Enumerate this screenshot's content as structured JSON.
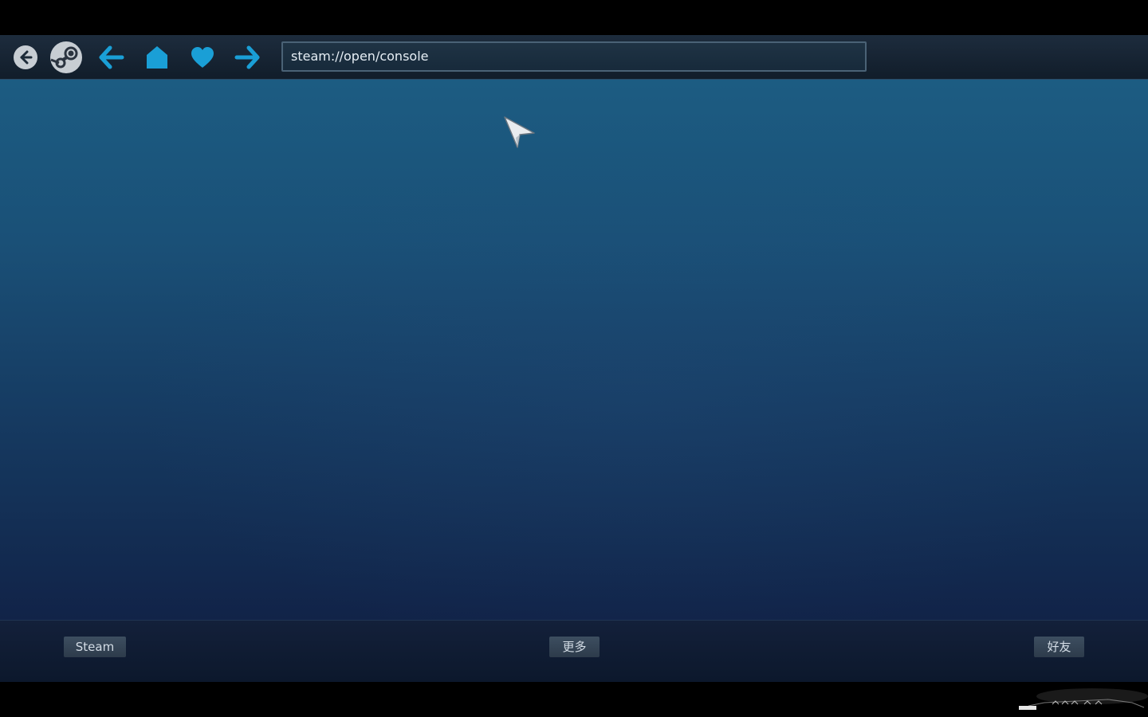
{
  "toolbar": {
    "url_value": "steam://open/console",
    "icons": [
      "back-circle-icon",
      "steam-logo-icon",
      "arrow-left-icon",
      "home-icon",
      "heart-icon",
      "arrow-right-icon"
    ]
  },
  "footer": {
    "steam_label": "Steam",
    "more_label": "更多",
    "friends_label": "好友"
  },
  "colors": {
    "accent": "#1a9fd6",
    "content_top": "#1c5c82",
    "content_bottom": "#112348"
  }
}
